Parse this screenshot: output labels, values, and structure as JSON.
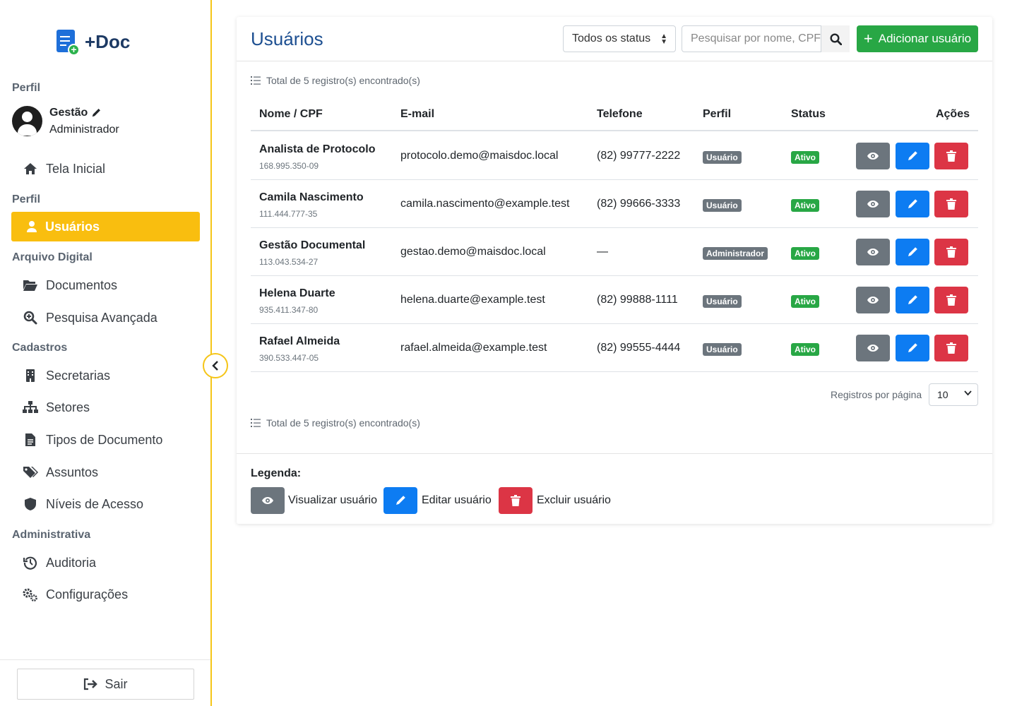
{
  "app": {
    "logo_text": "+Doc"
  },
  "sidebar": {
    "profile_section": "Perfil",
    "user_name": "Gestão",
    "user_role": "Administrador",
    "home_label": "Tela Inicial",
    "perfil_section": "Perfil",
    "users_label": "Usuários",
    "archive_section": "Arquivo Digital",
    "documents_label": "Documentos",
    "advanced_search_label": "Pesquisa Avançada",
    "registers_section": "Cadastros",
    "secretarias_label": "Secretarias",
    "setores_label": "Setores",
    "doc_types_label": "Tipos de Documento",
    "assuntos_label": "Assuntos",
    "access_levels_label": "Níveis de Acesso",
    "admin_section": "Administrativa",
    "audit_label": "Auditoria",
    "settings_label": "Configurações",
    "logout_label": "Sair"
  },
  "header": {
    "title": "Usuários",
    "status_filter": "Todos os status",
    "search_placeholder": "Pesquisar por nome, CPF",
    "add_button": "Adicionar usuário"
  },
  "summary": {
    "total_text": "Total de 5 registro(s) encontrado(s)"
  },
  "table": {
    "columns": {
      "name": "Nome / CPF",
      "email": "E-mail",
      "phone": "Telefone",
      "perfil": "Perfil",
      "status": "Status",
      "actions": "Ações"
    },
    "rows": [
      {
        "name": "Analista de Protocolo",
        "cpf": "168.995.350-09",
        "email": "protocolo.demo@maisdoc.local",
        "phone": "(82) 99777-2222",
        "perfil": "Usuário",
        "status": "Ativo"
      },
      {
        "name": "Camila Nascimento",
        "cpf": "111.444.777-35",
        "email": "camila.nascimento@example.test",
        "phone": "(82) 99666-3333",
        "perfil": "Usuário",
        "status": "Ativo"
      },
      {
        "name": "Gestão Documental",
        "cpf": "113.043.534-27",
        "email": "gestao.demo@maisdoc.local",
        "phone": "—",
        "perfil": "Administrador",
        "status": "Ativo"
      },
      {
        "name": "Helena Duarte",
        "cpf": "935.411.347-80",
        "email": "helena.duarte@example.test",
        "phone": "(82) 99888-1111",
        "perfil": "Usuário",
        "status": "Ativo"
      },
      {
        "name": "Rafael Almeida",
        "cpf": "390.533.447-05",
        "email": "rafael.almeida@example.test",
        "phone": "(82) 99555-4444",
        "perfil": "Usuário",
        "status": "Ativo"
      }
    ]
  },
  "pagination": {
    "per_page_label": "Registros por página",
    "per_page_value": "10"
  },
  "legend": {
    "title": "Legenda:",
    "view": "Visualizar usuário",
    "edit": "Editar usuário",
    "delete": "Excluir usuário"
  },
  "colors": {
    "accent": "#f9be0f",
    "primary": "#0d7cf2",
    "success": "#28a745",
    "danger": "#dc3545",
    "secondary": "#6c757d",
    "title": "#1d4f91"
  }
}
